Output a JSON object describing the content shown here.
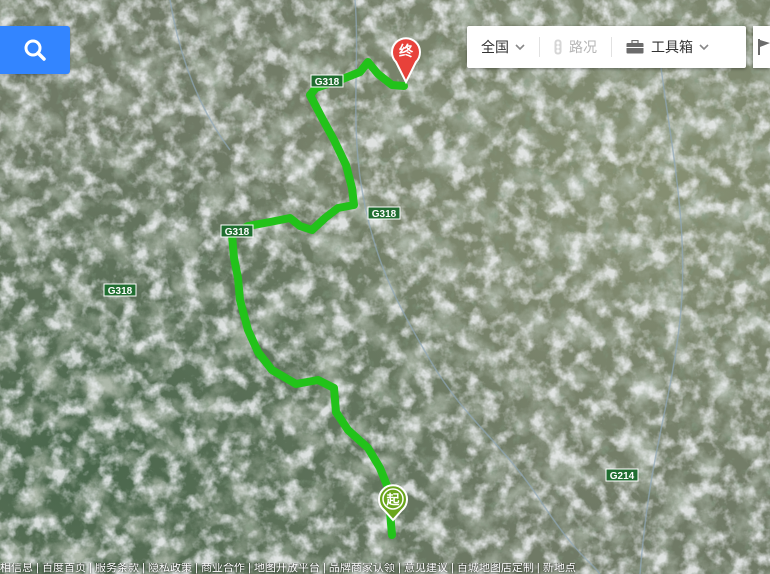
{
  "search": {
    "icon": "search-icon"
  },
  "toolbar": {
    "region_label": "全国",
    "traffic_label": "路况",
    "tools_label": "工具箱",
    "region_icon": "chevron-down-icon",
    "traffic_icon": "traffic-light-icon",
    "tools_icon": "toolbox-icon",
    "flag_icon": "flag-icon"
  },
  "markers": {
    "start_label": "起",
    "end_label": "终",
    "start_color": "#6aa51c",
    "end_color": "#e8413a"
  },
  "route": {
    "color": "#22c21a"
  },
  "road_labels": [
    "G318",
    "G318",
    "G318",
    "G318",
    "G214"
  ],
  "footer": {
    "links": [
      "相信息",
      "百度首页",
      "服务条款",
      "隐私政策",
      "商业合作",
      "地图开放平台",
      "品牌商家认领",
      "意见建议",
      "百城地图店定制",
      "新地点"
    ],
    "separator": " | "
  }
}
